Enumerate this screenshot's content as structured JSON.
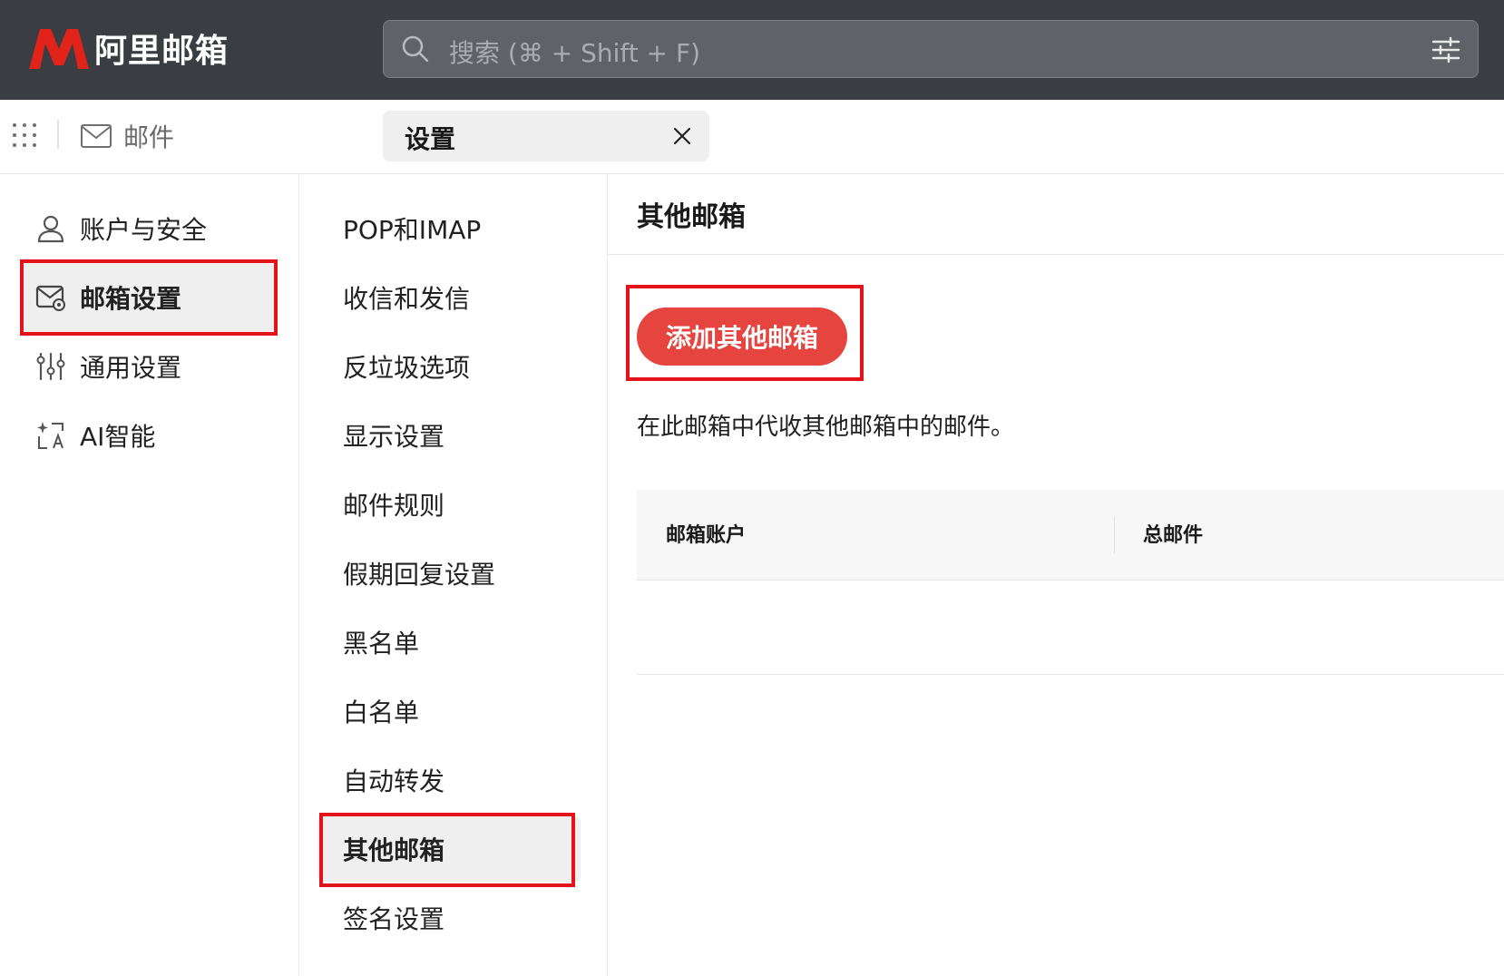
{
  "header": {
    "brand": "阿里邮箱",
    "search_placeholder": "搜索 (⌘ + Shift + F)"
  },
  "navbar": {
    "mail_tab": "邮件",
    "settings_tab": "设置"
  },
  "sidebar": {
    "items": [
      {
        "label": "账户与安全",
        "icon": "user-icon"
      },
      {
        "label": "邮箱设置",
        "icon": "mail-settings-icon",
        "active": true
      },
      {
        "label": "通用设置",
        "icon": "sliders-icon"
      },
      {
        "label": "AI智能",
        "icon": "ai-translate-icon"
      }
    ]
  },
  "submenu": {
    "items": [
      {
        "label": "POP和IMAP"
      },
      {
        "label": "收信和发信"
      },
      {
        "label": "反垃圾选项"
      },
      {
        "label": "显示设置"
      },
      {
        "label": "邮件规则"
      },
      {
        "label": "假期回复设置"
      },
      {
        "label": "黑名单"
      },
      {
        "label": "白名单"
      },
      {
        "label": "自动转发"
      },
      {
        "label": "其他邮箱",
        "active": true
      },
      {
        "label": "签名设置"
      }
    ]
  },
  "main": {
    "title": "其他邮箱",
    "add_button": "添加其他邮箱",
    "description": "在此邮箱中代收其他邮箱中的邮件。",
    "table": {
      "columns": [
        "邮箱账户",
        "总邮件"
      ]
    }
  },
  "colors": {
    "topbar": "#3a3d42",
    "accent": "#e6453f",
    "highlight_box": "#e3121b",
    "active_bg": "#efefef"
  }
}
